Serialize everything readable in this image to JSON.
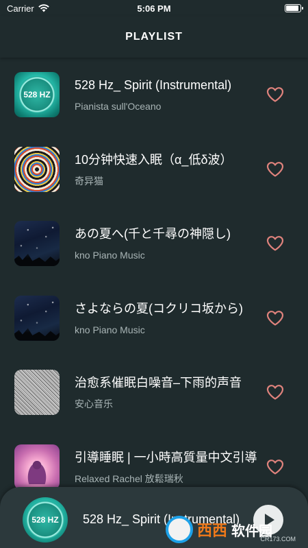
{
  "status_bar": {
    "carrier": "Carrier",
    "time": "5:06 PM"
  },
  "nav": {
    "title": "PLAYLIST"
  },
  "tracks": [
    {
      "title": "528 Hz_ Spirit (Instrumental)",
      "artist": "Pianista sull'Oceano",
      "cover_text": "528 HZ",
      "cover": "528-hz-cover"
    },
    {
      "title": "10分钟快速入眠（α_低δ波）",
      "artist": "奇异猫",
      "cover": "spiral-cover"
    },
    {
      "title": "あの夏へ(千と千尋の神隠し)",
      "artist": "kno Piano Music",
      "cover": "night-sky-cover"
    },
    {
      "title": "さよならの夏(コクリコ坂から)",
      "artist": "kno Piano Music",
      "cover": "night-sky-cover"
    },
    {
      "title": "治愈系催眠白噪音–下雨的声音",
      "artist": "安心音乐",
      "cover": "white-noise-cover"
    },
    {
      "title": "引導睡眠 | 一小時高質量中文引導",
      "artist": "Relaxed Rachel 放鬆瑞秋",
      "cover": "meditation-cover"
    }
  ],
  "player": {
    "title": "528 Hz_ Spirit (Instrumental)",
    "cover_text": "528 HZ"
  },
  "watermark": {
    "text_a": "西西",
    "text_b": "软件园",
    "sub": "CR173.COM"
  },
  "colors": {
    "background": "#1f2b2d",
    "player": "#2c393c",
    "heart": "#e0837d",
    "artist_text": "#a9b5b6"
  }
}
